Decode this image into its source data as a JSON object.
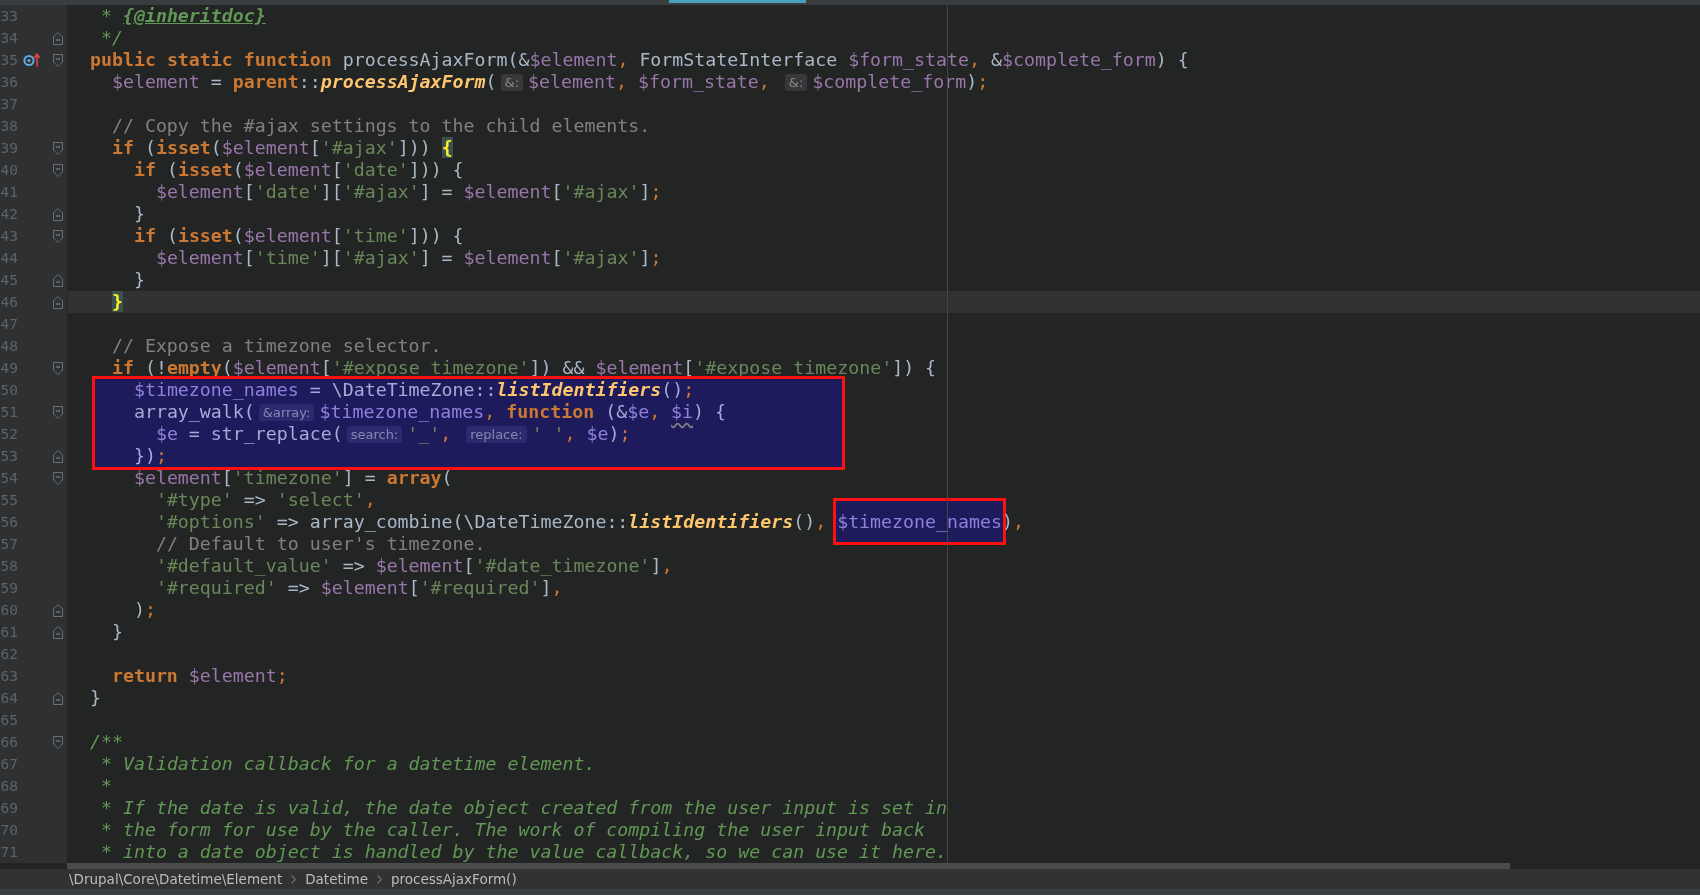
{
  "editor": {
    "lines": [
      {
        "number": "33",
        "current": false,
        "highlighted": false,
        "fold_start": false,
        "fold_end": false,
        "override_marker": false,
        "tokens": [
          {
            "text": "   * ",
            "kind": "doc"
          },
          {
            "text": "{@inheritdoc}",
            "kind": "doc-tag"
          }
        ]
      },
      {
        "number": "34",
        "current": false,
        "highlighted": false,
        "fold_start": false,
        "fold_end": true,
        "override_marker": false,
        "tokens": [
          {
            "text": "   */",
            "kind": "doc"
          }
        ]
      },
      {
        "number": "35",
        "current": false,
        "highlighted": false,
        "fold_start": true,
        "fold_end": false,
        "override_marker": true,
        "tokens": [
          {
            "text": "  public static function",
            "kind": "keyword"
          },
          {
            "text": " processAjaxForm(&",
            "kind": "plain"
          },
          {
            "text": "$element",
            "kind": "var"
          },
          {
            "text": ", ",
            "kind": "punct"
          },
          {
            "text": "FormStateInterface ",
            "kind": "plain"
          },
          {
            "text": "$form_state",
            "kind": "var"
          },
          {
            "text": ", ",
            "kind": "punct"
          },
          {
            "text": "&",
            "kind": "plain"
          },
          {
            "text": "$complete_form",
            "kind": "var"
          },
          {
            "text": ") {",
            "kind": "plain"
          }
        ]
      },
      {
        "number": "36",
        "current": false,
        "highlighted": false,
        "fold_start": false,
        "fold_end": false,
        "override_marker": false,
        "tokens": [
          {
            "text": "    $element",
            "kind": "var"
          },
          {
            "text": " = ",
            "kind": "plain"
          },
          {
            "text": "parent",
            "kind": "keyword"
          },
          {
            "text": "::",
            "kind": "plain"
          },
          {
            "text": "processAjaxForm",
            "kind": "static"
          },
          {
            "text": "(",
            "kind": "plain"
          },
          {
            "text": "&:",
            "kind": "hint"
          },
          {
            "text": "$element",
            "kind": "var"
          },
          {
            "text": ", ",
            "kind": "punct"
          },
          {
            "text": "$form_state",
            "kind": "var"
          },
          {
            "text": ", ",
            "kind": "punct"
          },
          {
            "text": "&:",
            "kind": "hint"
          },
          {
            "text": "$complete_form",
            "kind": "var"
          },
          {
            "text": ")",
            "kind": "plain"
          },
          {
            "text": ";",
            "kind": "punct"
          }
        ]
      },
      {
        "number": "37",
        "current": false,
        "highlighted": false,
        "fold_start": false,
        "fold_end": false,
        "override_marker": false
      },
      {
        "number": "38",
        "current": false,
        "highlighted": false,
        "fold_start": false,
        "fold_end": false,
        "override_marker": false,
        "tokens": [
          {
            "text": "    // Copy the #ajax settings to the child elements.",
            "kind": "comment"
          }
        ]
      },
      {
        "number": "39",
        "current": false,
        "highlighted": false,
        "fold_start": true,
        "fold_end": false,
        "override_marker": false,
        "tokens": [
          {
            "text": "    if",
            "kind": "keyword"
          },
          {
            "text": " (",
            "kind": "plain"
          },
          {
            "text": "isset",
            "kind": "keyword"
          },
          {
            "text": "(",
            "kind": "plain"
          },
          {
            "text": "$element",
            "kind": "var"
          },
          {
            "text": "[",
            "kind": "plain"
          },
          {
            "text": "'#ajax'",
            "kind": "string"
          },
          {
            "text": "])) ",
            "kind": "plain"
          },
          {
            "text": "{",
            "kind": "brace"
          }
        ]
      },
      {
        "number": "40",
        "current": false,
        "highlighted": false,
        "fold_start": true,
        "fold_end": false,
        "override_marker": false,
        "tokens": [
          {
            "text": "      if",
            "kind": "keyword"
          },
          {
            "text": " (",
            "kind": "plain"
          },
          {
            "text": "isset",
            "kind": "keyword"
          },
          {
            "text": "(",
            "kind": "plain"
          },
          {
            "text": "$element",
            "kind": "var"
          },
          {
            "text": "[",
            "kind": "plain"
          },
          {
            "text": "'date'",
            "kind": "string"
          },
          {
            "text": "])) {",
            "kind": "plain"
          }
        ]
      },
      {
        "number": "41",
        "current": false,
        "highlighted": false,
        "fold_start": false,
        "fold_end": false,
        "override_marker": false,
        "tokens": [
          {
            "text": "        $element",
            "kind": "var"
          },
          {
            "text": "[",
            "kind": "plain"
          },
          {
            "text": "'date'",
            "kind": "string"
          },
          {
            "text": "][",
            "kind": "plain"
          },
          {
            "text": "'#ajax'",
            "kind": "string"
          },
          {
            "text": "] = ",
            "kind": "plain"
          },
          {
            "text": "$element",
            "kind": "var"
          },
          {
            "text": "[",
            "kind": "plain"
          },
          {
            "text": "'#ajax'",
            "kind": "string"
          },
          {
            "text": "]",
            "kind": "plain"
          },
          {
            "text": ";",
            "kind": "punct"
          }
        ]
      },
      {
        "number": "42",
        "current": false,
        "highlighted": false,
        "fold_start": false,
        "fold_end": true,
        "override_marker": false,
        "tokens": [
          {
            "text": "      }",
            "kind": "plain"
          }
        ]
      },
      {
        "number": "43",
        "current": false,
        "highlighted": false,
        "fold_start": true,
        "fold_end": false,
        "override_marker": false,
        "tokens": [
          {
            "text": "      if",
            "kind": "keyword"
          },
          {
            "text": " (",
            "kind": "plain"
          },
          {
            "text": "isset",
            "kind": "keyword"
          },
          {
            "text": "(",
            "kind": "plain"
          },
          {
            "text": "$element",
            "kind": "var"
          },
          {
            "text": "[",
            "kind": "plain"
          },
          {
            "text": "'time'",
            "kind": "string"
          },
          {
            "text": "])) {",
            "kind": "plain"
          }
        ]
      },
      {
        "number": "44",
        "current": false,
        "highlighted": false,
        "fold_start": false,
        "fold_end": false,
        "override_marker": false,
        "tokens": [
          {
            "text": "        $element",
            "kind": "var"
          },
          {
            "text": "[",
            "kind": "plain"
          },
          {
            "text": "'time'",
            "kind": "string"
          },
          {
            "text": "][",
            "kind": "plain"
          },
          {
            "text": "'#ajax'",
            "kind": "string"
          },
          {
            "text": "] = ",
            "kind": "plain"
          },
          {
            "text": "$element",
            "kind": "var"
          },
          {
            "text": "[",
            "kind": "plain"
          },
          {
            "text": "'#ajax'",
            "kind": "string"
          },
          {
            "text": "]",
            "kind": "plain"
          },
          {
            "text": ";",
            "kind": "punct"
          }
        ]
      },
      {
        "number": "45",
        "current": false,
        "highlighted": false,
        "fold_start": false,
        "fold_end": true,
        "override_marker": false,
        "tokens": [
          {
            "text": "      }",
            "kind": "plain"
          }
        ]
      },
      {
        "number": "46",
        "current": true,
        "highlighted": false,
        "fold_start": false,
        "fold_end": true,
        "override_marker": false,
        "tokens": [
          {
            "text": "    }",
            "kind": "brace"
          }
        ]
      },
      {
        "number": "47",
        "current": false,
        "highlighted": false,
        "fold_start": false,
        "fold_end": false,
        "override_marker": false
      },
      {
        "number": "48",
        "current": false,
        "highlighted": false,
        "fold_start": false,
        "fold_end": false,
        "override_marker": false,
        "tokens": [
          {
            "text": "    // Expose a timezone selector.",
            "kind": "comment"
          }
        ]
      },
      {
        "number": "49",
        "current": false,
        "highlighted": false,
        "fold_start": true,
        "fold_end": false,
        "override_marker": false,
        "tokens": [
          {
            "text": "    if",
            "kind": "keyword"
          },
          {
            "text": " (!",
            "kind": "plain"
          },
          {
            "text": "empty",
            "kind": "keyword"
          },
          {
            "text": "(",
            "kind": "plain"
          },
          {
            "text": "$element",
            "kind": "var"
          },
          {
            "text": "[",
            "kind": "plain"
          },
          {
            "text": "'#expose timezone'",
            "kind": "string"
          },
          {
            "text": "]) && ",
            "kind": "plain"
          },
          {
            "text": "$element",
            "kind": "var"
          },
          {
            "text": "[",
            "kind": "plain"
          },
          {
            "text": "'#expose timezone'",
            "kind": "string"
          },
          {
            "text": "]) {",
            "kind": "plain"
          }
        ]
      },
      {
        "number": "50",
        "current": false,
        "highlighted": true,
        "fold_start": false,
        "fold_end": false,
        "override_marker": false,
        "tokens": [
          {
            "text": "      $timezone_names",
            "kind": "var"
          },
          {
            "text": " = \\DateTimeZone::",
            "kind": "plain"
          },
          {
            "text": "listIdentifiers",
            "kind": "static"
          },
          {
            "text": "()",
            "kind": "plain"
          },
          {
            "text": ";",
            "kind": "punct"
          }
        ]
      },
      {
        "number": "51",
        "current": false,
        "highlighted": true,
        "fold_start": true,
        "fold_end": false,
        "override_marker": false,
        "tokens": [
          {
            "text": "      array_walk(",
            "kind": "plain"
          },
          {
            "text": "&array:",
            "kind": "hint"
          },
          {
            "text": "$timezone_names",
            "kind": "var"
          },
          {
            "text": ", ",
            "kind": "punct"
          },
          {
            "text": "function",
            "kind": "keyword"
          },
          {
            "text": " (&",
            "kind": "plain"
          },
          {
            "text": "$e",
            "kind": "var"
          },
          {
            "text": ", ",
            "kind": "punct"
          },
          {
            "text": "$i",
            "kind": "var-unused"
          },
          {
            "text": ") {",
            "kind": "plain"
          }
        ]
      },
      {
        "number": "52",
        "current": false,
        "highlighted": true,
        "fold_start": false,
        "fold_end": false,
        "override_marker": false,
        "tokens": [
          {
            "text": "        $e",
            "kind": "var"
          },
          {
            "text": " = str_replace(",
            "kind": "plain"
          },
          {
            "text": "search:",
            "kind": "hint"
          },
          {
            "text": "'_'",
            "kind": "string"
          },
          {
            "text": ", ",
            "kind": "punct"
          },
          {
            "text": "replace:",
            "kind": "hint"
          },
          {
            "text": "' '",
            "kind": "string"
          },
          {
            "text": ", ",
            "kind": "punct"
          },
          {
            "text": "$e",
            "kind": "var"
          },
          {
            "text": ")",
            "kind": "plain"
          },
          {
            "text": ";",
            "kind": "punct"
          }
        ]
      },
      {
        "number": "53",
        "current": false,
        "highlighted": true,
        "fold_start": false,
        "fold_end": true,
        "override_marker": false,
        "tokens": [
          {
            "text": "      })",
            "kind": "plain"
          },
          {
            "text": ";",
            "kind": "punct"
          }
        ]
      },
      {
        "number": "54",
        "current": false,
        "highlighted": false,
        "fold_start": true,
        "fold_end": false,
        "override_marker": false,
        "tokens": [
          {
            "text": "      $element",
            "kind": "var"
          },
          {
            "text": "[",
            "kind": "plain"
          },
          {
            "text": "'timezone'",
            "kind": "string"
          },
          {
            "text": "] = ",
            "kind": "plain"
          },
          {
            "text": "array",
            "kind": "keyword"
          },
          {
            "text": "(",
            "kind": "plain"
          }
        ]
      },
      {
        "number": "55",
        "current": false,
        "highlighted": false,
        "fold_start": false,
        "fold_end": false,
        "override_marker": false,
        "tokens": [
          {
            "text": "        '#type'",
            "kind": "string"
          },
          {
            "text": " => ",
            "kind": "plain"
          },
          {
            "text": "'select'",
            "kind": "string"
          },
          {
            "text": ",",
            "kind": "punct"
          }
        ]
      },
      {
        "number": "56",
        "current": false,
        "highlighted": false,
        "fold_start": false,
        "fold_end": false,
        "override_marker": false,
        "tokens": [
          {
            "text": "        '#options'",
            "kind": "string"
          },
          {
            "text": " => array_combine(\\DateTimeZone::",
            "kind": "plain"
          },
          {
            "text": "listIdentifiers",
            "kind": "static"
          },
          {
            "text": "()",
            "kind": "plain"
          },
          {
            "text": ", ",
            "kind": "punct"
          },
          {
            "text": "$timezone_names",
            "kind": "marked"
          },
          {
            "text": ")",
            "kind": "plain"
          },
          {
            "text": ",",
            "kind": "punct"
          }
        ]
      },
      {
        "number": "57",
        "current": false,
        "highlighted": false,
        "fold_start": false,
        "fold_end": false,
        "override_marker": false,
        "tokens": [
          {
            "text": "        // Default to user's timezone.",
            "kind": "comment"
          }
        ]
      },
      {
        "number": "58",
        "current": false,
        "highlighted": false,
        "fold_start": false,
        "fold_end": false,
        "override_marker": false,
        "tokens": [
          {
            "text": "        '#default_value'",
            "kind": "string"
          },
          {
            "text": " => ",
            "kind": "plain"
          },
          {
            "text": "$element",
            "kind": "var"
          },
          {
            "text": "[",
            "kind": "plain"
          },
          {
            "text": "'#date_timezone'",
            "kind": "string"
          },
          {
            "text": "]",
            "kind": "plain"
          },
          {
            "text": ",",
            "kind": "punct"
          }
        ]
      },
      {
        "number": "59",
        "current": false,
        "highlighted": false,
        "fold_start": false,
        "fold_end": false,
        "override_marker": false,
        "tokens": [
          {
            "text": "        '#required'",
            "kind": "string"
          },
          {
            "text": " => ",
            "kind": "plain"
          },
          {
            "text": "$element",
            "kind": "var"
          },
          {
            "text": "[",
            "kind": "plain"
          },
          {
            "text": "'#required'",
            "kind": "string"
          },
          {
            "text": "]",
            "kind": "plain"
          },
          {
            "text": ",",
            "kind": "punct"
          }
        ]
      },
      {
        "number": "60",
        "current": false,
        "highlighted": false,
        "fold_start": false,
        "fold_end": true,
        "override_marker": false,
        "tokens": [
          {
            "text": "      )",
            "kind": "plain"
          },
          {
            "text": ";",
            "kind": "punct"
          }
        ]
      },
      {
        "number": "61",
        "current": false,
        "highlighted": false,
        "fold_start": false,
        "fold_end": true,
        "override_marker": false,
        "tokens": [
          {
            "text": "    }",
            "kind": "plain"
          }
        ]
      },
      {
        "number": "62",
        "current": false,
        "highlighted": false,
        "fold_start": false,
        "fold_end": false,
        "override_marker": false
      },
      {
        "number": "63",
        "current": false,
        "highlighted": false,
        "fold_start": false,
        "fold_end": false,
        "override_marker": false,
        "tokens": [
          {
            "text": "    return ",
            "kind": "keyword"
          },
          {
            "text": "$element",
            "kind": "var"
          },
          {
            "text": ";",
            "kind": "punct"
          }
        ]
      },
      {
        "number": "64",
        "current": false,
        "highlighted": false,
        "fold_start": false,
        "fold_end": true,
        "override_marker": false,
        "tokens": [
          {
            "text": "  }",
            "kind": "plain"
          }
        ]
      },
      {
        "number": "65",
        "current": false,
        "highlighted": false,
        "fold_start": false,
        "fold_end": false,
        "override_marker": false
      },
      {
        "number": "66",
        "current": false,
        "highlighted": false,
        "fold_start": true,
        "fold_end": false,
        "override_marker": false,
        "tokens": [
          {
            "text": "  /**",
            "kind": "doc"
          }
        ]
      },
      {
        "number": "67",
        "current": false,
        "highlighted": false,
        "fold_start": false,
        "fold_end": false,
        "override_marker": false,
        "tokens": [
          {
            "text": "   * Validation callback for a datetime element.",
            "kind": "doc"
          }
        ]
      },
      {
        "number": "68",
        "current": false,
        "highlighted": false,
        "fold_start": false,
        "fold_end": false,
        "override_marker": false,
        "tokens": [
          {
            "text": "   *",
            "kind": "doc"
          }
        ]
      },
      {
        "number": "69",
        "current": false,
        "highlighted": false,
        "fold_start": false,
        "fold_end": false,
        "override_marker": false,
        "tokens": [
          {
            "text": "   * If the date is valid, the date object created from the user input is set in",
            "kind": "doc"
          }
        ]
      },
      {
        "number": "70",
        "current": false,
        "highlighted": false,
        "fold_start": false,
        "fold_end": false,
        "override_marker": false,
        "tokens": [
          {
            "text": "   * the form for use by the caller. The work of compiling the user input back",
            "kind": "doc"
          }
        ]
      },
      {
        "number": "71",
        "current": false,
        "highlighted": false,
        "fold_start": false,
        "fold_end": false,
        "override_marker": false,
        "tokens": [
          {
            "text": "   * into a date object is handled by the value callback, so we can use it here.",
            "kind": "doc"
          }
        ]
      }
    ]
  },
  "breadcrumbs": [
    "\\Drupal\\Core\\Datetime\\Element",
    "Datetime",
    "processAjaxForm()"
  ]
}
